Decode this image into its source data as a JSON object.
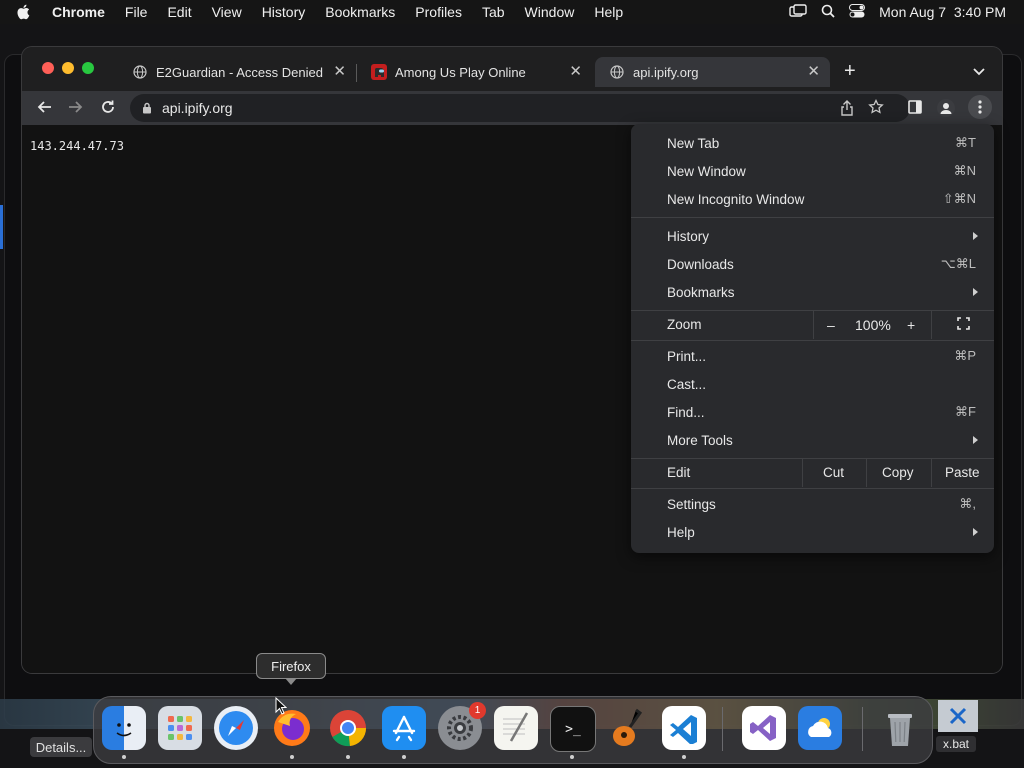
{
  "menubar": {
    "app_name": "Chrome",
    "items": [
      "File",
      "Edit",
      "View",
      "History",
      "Bookmarks",
      "Profiles",
      "Tab",
      "Window",
      "Help"
    ],
    "clock": "Mon Aug 7  3:40 PM"
  },
  "browser": {
    "tabs": [
      {
        "title": "E2Guardian - Access Denied",
        "favicon": "globe-icon",
        "active": false
      },
      {
        "title": "Among Us Play Online",
        "favicon": "among-us-icon",
        "active": false
      },
      {
        "title": "api.ipify.org",
        "favicon": "globe-icon",
        "active": true
      }
    ],
    "address": "api.ipify.org",
    "page_text": "143.244.47.73"
  },
  "chrome_menu": {
    "items": {
      "new_tab": {
        "label": "New Tab",
        "shortcut": "⌘T"
      },
      "new_window": {
        "label": "New Window",
        "shortcut": "⌘N"
      },
      "new_incognito": {
        "label": "New Incognito Window",
        "shortcut": "⇧⌘N"
      },
      "history": {
        "label": "History"
      },
      "downloads": {
        "label": "Downloads",
        "shortcut": "⌥⌘L"
      },
      "bookmarks": {
        "label": "Bookmarks"
      },
      "zoom": {
        "label": "Zoom",
        "minus": "–",
        "value": "100%",
        "plus": "+"
      },
      "print": {
        "label": "Print...",
        "shortcut": "⌘P"
      },
      "cast": {
        "label": "Cast..."
      },
      "find": {
        "label": "Find...",
        "shortcut": "⌘F"
      },
      "more_tools": {
        "label": "More Tools"
      },
      "edit": {
        "label": "Edit",
        "cut": "Cut",
        "copy": "Copy",
        "paste": "Paste"
      },
      "settings": {
        "label": "Settings",
        "shortcut": "⌘,"
      },
      "help": {
        "label": "Help"
      }
    }
  },
  "dock": {
    "tooltip": "Firefox",
    "apps": [
      "finder",
      "launchpad",
      "safari",
      "firefox",
      "chrome",
      "app-store",
      "system-settings",
      "textedit",
      "terminal",
      "garageband",
      "vscode",
      "visual-studio",
      "weather",
      "trash"
    ],
    "settings_badge": "1",
    "details_label": "Details...",
    "file_label": "x.bat"
  },
  "colors": {
    "accent": "#2a6fd6",
    "menu_bg": "#292a2d",
    "toolbar_bg": "#35363a"
  }
}
